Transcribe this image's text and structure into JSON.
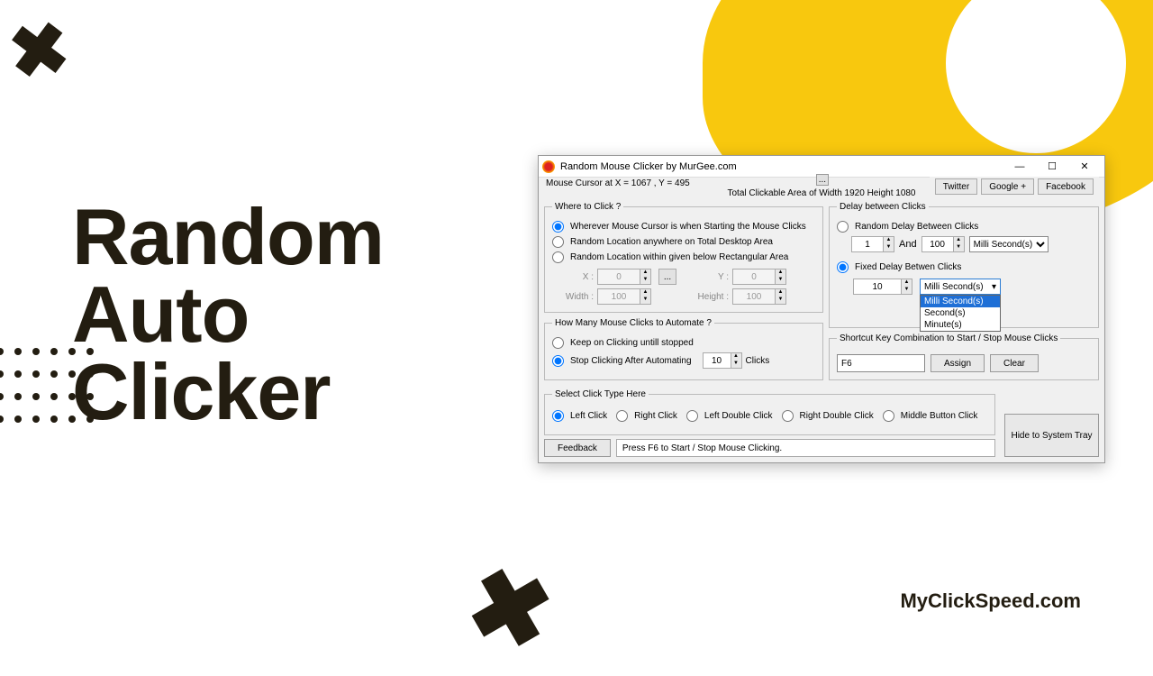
{
  "page_title_l1": "Random",
  "page_title_l2": "Auto",
  "page_title_l3": "Clicker",
  "footer_brand": "MyClickSpeed.com",
  "window": {
    "title": "Random Mouse Clicker by MurGee.com",
    "btn_min": "—",
    "btn_max": "☐",
    "btn_close": "✕",
    "twitter": "Twitter",
    "googleplus": "Google +",
    "facebook": "Facebook",
    "cursor_status": "Mouse Cursor at X = 1067 , Y = 495",
    "tick": "...",
    "area_status": "Total Clickable Area of Width 1920 Height 1080"
  },
  "where": {
    "legend": "Where to Click ?",
    "opt1": "Wherever Mouse Cursor is when Starting the Mouse Clicks",
    "opt2": "Random Location anywhere on Total Desktop Area",
    "opt3": "Random Location within given below Rectangular Area",
    "x_lbl": "X :",
    "y_lbl": "Y :",
    "w_lbl": "Width :",
    "h_lbl": "Height :",
    "x_val": "0",
    "y_val": "0",
    "w_val": "100",
    "h_val": "100",
    "pick": "..."
  },
  "howmany": {
    "legend": "How Many Mouse Clicks to Automate ?",
    "opt1": "Keep on Clicking untill stopped",
    "opt2": "Stop Clicking After Automating",
    "val": "10",
    "unit": "Clicks"
  },
  "delay": {
    "legend": "Delay between Clicks",
    "opt1": "Random Delay Between Clicks",
    "v1": "1",
    "and": "And",
    "v2": "100",
    "unit1": "Milli Second(s)",
    "opt2": "Fixed Delay Betwen Clicks",
    "fixed_val": "10",
    "combo_sel": "Milli Second(s)",
    "combo_o1": "Milli Second(s)",
    "combo_o2": "Second(s)",
    "combo_o3": "Minute(s)"
  },
  "shortcut": {
    "legend": "Shortcut Key Combination to Start / Stop Mouse Clicks",
    "val": "F6",
    "assign": "Assign",
    "clear": "Clear"
  },
  "clicktype": {
    "legend": "Select Click Type Here",
    "o1": "Left Click",
    "o2": "Right Click",
    "o3": "Left Double Click",
    "o4": "Right Double Click",
    "o5": "Middle Button Click"
  },
  "bottom": {
    "feedback": "Feedback",
    "status": "Press F6 to Start / Stop Mouse Clicking.",
    "hide": "Hide to System Tray"
  }
}
